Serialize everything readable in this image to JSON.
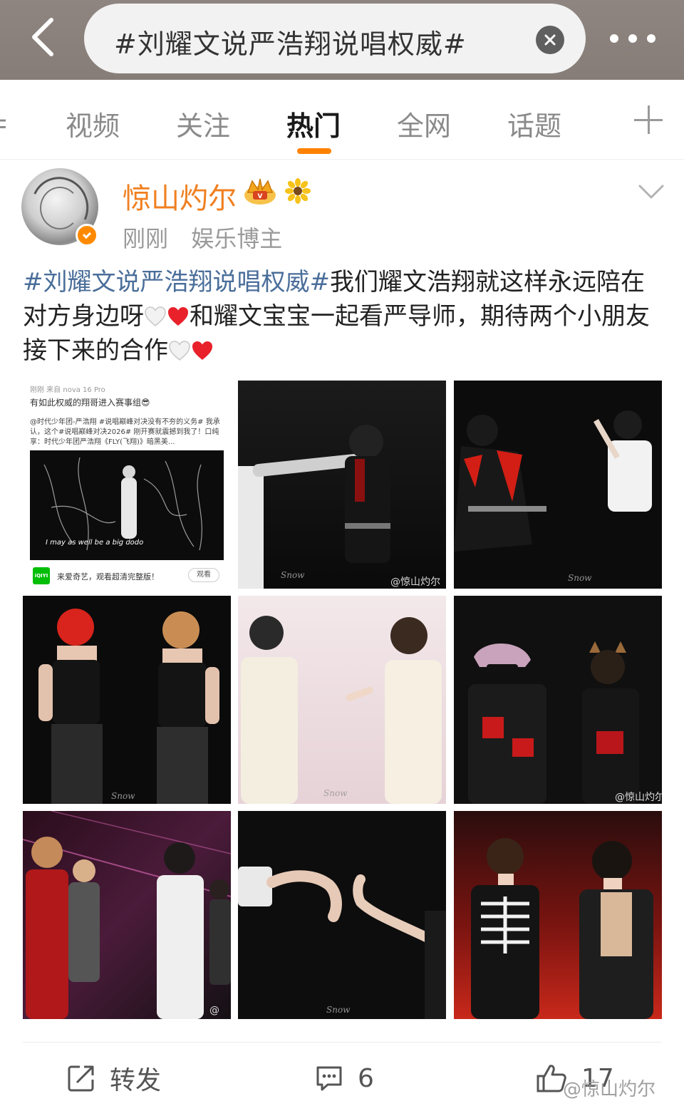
{
  "search": {
    "query": "#刘耀文说严浩翔说唱权威#"
  },
  "tabs": [
    {
      "label": "视频"
    },
    {
      "label": "关注"
    },
    {
      "label": "热门"
    },
    {
      "label": "全网"
    },
    {
      "label": "话题"
    }
  ],
  "active_tab": "热门",
  "post": {
    "username": "惊山灼尔",
    "time": "刚刚",
    "role": "娱乐博主",
    "hashtag": "#刘耀文说严浩翔说唱权威#",
    "text_part1": "我们耀文浩翔就这样永远陪在对方身边呀",
    "text_part2": "和耀文宝宝一起看严导师，期待两个小朋友接下来的合作",
    "images": [
      {
        "header": "刚刚  来自 nova 16 Pro",
        "line1": "有如此权威的翔哥进入赛事组😎",
        "body": "@时代少年团-严浩翔 #说唱巅峰对决没有不夯的义务# 我承认，这个#说唱巅峰对决2026# 刚开赛就震撼到我了！口纯享：时代少年团严浩翔《FLY(飞翔)》暗黑美...",
        "caption": "I may as well be a big dodo",
        "promo": "来爱奇艺，观看超清完整版！",
        "watch": "观看"
      },
      {
        "watermark": "@惊山灼尔",
        "signature": "Snow"
      },
      {
        "signature": "Snow"
      },
      {
        "signature": "Snow"
      },
      {
        "signature": "Snow"
      },
      {
        "watermark": "@惊山灼尔"
      },
      {
        "watermark": "@"
      },
      {
        "signature": "Snow"
      },
      {}
    ]
  },
  "actions": {
    "repost_label": "转发",
    "comment_count": "6",
    "like_count": "17"
  },
  "watermark": "@惊山灼尔",
  "colors": {
    "accent_orange": "#ff8200",
    "username_orange": "#f08021",
    "hashtag_blue": "#4a6e9a",
    "heart_red": "#e8212b"
  }
}
